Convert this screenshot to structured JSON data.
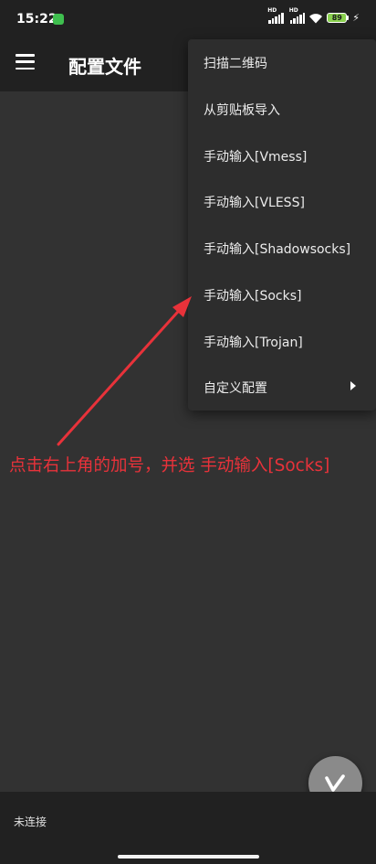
{
  "status_bar": {
    "time": "15:22",
    "network_badge_1": "HD",
    "network_badge_2": "HD",
    "battery_level": "89",
    "icons": [
      "app-notification-icon",
      "signal-1-icon",
      "signal-2-icon",
      "wifi-icon",
      "battery-icon",
      "charging-bolt-icon"
    ]
  },
  "app_bar": {
    "title": "配置文件",
    "menu_icon": "hamburger-menu-icon"
  },
  "overflow_menu": {
    "items": [
      {
        "label": "扫描二维码"
      },
      {
        "label": "从剪贴板导入"
      },
      {
        "label": "手动输入[Vmess]"
      },
      {
        "label": "手动输入[VLESS]"
      },
      {
        "label": "手动输入[Shadowsocks]"
      },
      {
        "label": "手动输入[Socks]"
      },
      {
        "label": "手动输入[Trojan]"
      },
      {
        "label": "自定义配置",
        "has_submenu": true
      }
    ]
  },
  "annotation": {
    "text": "点击右上角的加号，并选 手动输入[Socks]",
    "color": "#e8323a"
  },
  "fab": {
    "icon": "v2ray-logo-icon"
  },
  "bottom_bar": {
    "status": "未连接"
  },
  "colors": {
    "background": "#323232",
    "bar": "#212121",
    "menu": "#2d2d2d",
    "fab": "#8a8a8a",
    "battery": "#8ad14f"
  }
}
